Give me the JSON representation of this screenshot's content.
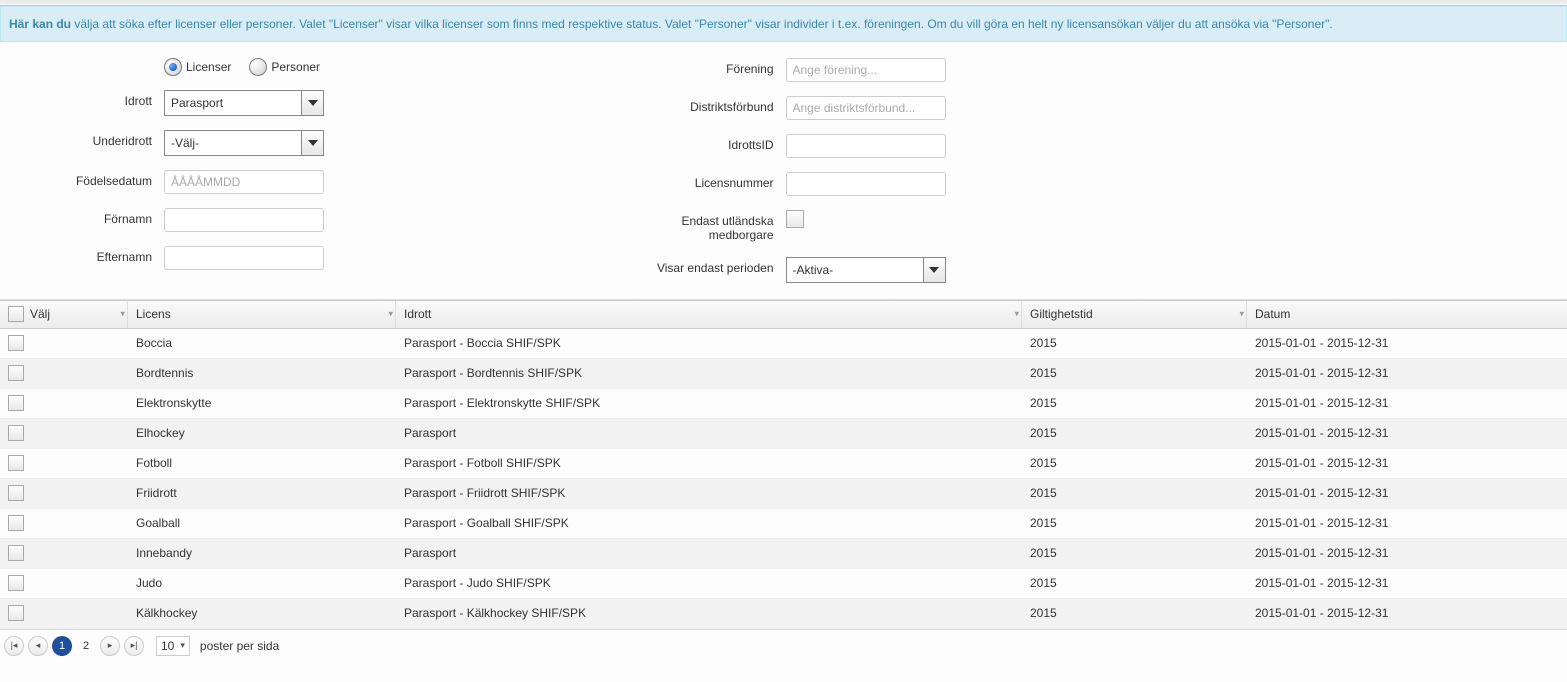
{
  "banner": {
    "bold": "Här kan du",
    "text": " välja att söka efter licenser eller personer. Valet \"Licenser\" visar vilka licenser som finns med respektive status. Valet \"Personer\" visar individer i t.ex. föreningen. Om du vill göra en helt ny licensansökan väljer du att ansöka via \"Personer\"."
  },
  "filters": {
    "radio": {
      "licenser": "Licenser",
      "personer": "Personer",
      "selected": "licenser"
    },
    "idrott_label": "Idrott",
    "idrott_value": "Parasport",
    "underidrott_label": "Underidrott",
    "underidrott_value": "-Välj-",
    "fodelsedatum_label": "Födelsedatum",
    "fodelsedatum_placeholder": "ÅÅÅÅMMDD",
    "fornamn_label": "Förnamn",
    "efternamn_label": "Efternamn",
    "forening_label": "Förening",
    "forening_placeholder": "Ange förening...",
    "distrikt_label": "Distriktsförbund",
    "distrikt_placeholder": "Ange distriktsförbund...",
    "idrottsid_label": "IdrottsID",
    "licensnummer_label": "Licensnummer",
    "endast_label1": "Endast utländska",
    "endast_label2": "medborgare",
    "period_label": "Visar endast perioden",
    "period_value": "-Aktiva-"
  },
  "grid": {
    "headers": {
      "valj": "Välj",
      "licens": "Licens",
      "idrott": "Idrott",
      "giltighetstid": "Giltighetstid",
      "datum": "Datum"
    },
    "rows": [
      {
        "licens": "Boccia",
        "idrott": "Parasport - Boccia SHIF/SPK",
        "gil": "2015",
        "datum": "2015-01-01 - 2015-12-31"
      },
      {
        "licens": "Bordtennis",
        "idrott": "Parasport - Bordtennis SHIF/SPK",
        "gil": "2015",
        "datum": "2015-01-01 - 2015-12-31"
      },
      {
        "licens": "Elektronskytte",
        "idrott": "Parasport - Elektronskytte SHIF/SPK",
        "gil": "2015",
        "datum": "2015-01-01 - 2015-12-31"
      },
      {
        "licens": "Elhockey",
        "idrott": "Parasport",
        "gil": "2015",
        "datum": "2015-01-01 - 2015-12-31"
      },
      {
        "licens": "Fotboll",
        "idrott": "Parasport - Fotboll SHIF/SPK",
        "gil": "2015",
        "datum": "2015-01-01 - 2015-12-31"
      },
      {
        "licens": "Friidrott",
        "idrott": "Parasport - Friidrott SHIF/SPK",
        "gil": "2015",
        "datum": "2015-01-01 - 2015-12-31"
      },
      {
        "licens": "Goalball",
        "idrott": "Parasport - Goalball SHIF/SPK",
        "gil": "2015",
        "datum": "2015-01-01 - 2015-12-31"
      },
      {
        "licens": "Innebandy",
        "idrott": "Parasport",
        "gil": "2015",
        "datum": "2015-01-01 - 2015-12-31"
      },
      {
        "licens": "Judo",
        "idrott": "Parasport - Judo SHIF/SPK",
        "gil": "2015",
        "datum": "2015-01-01 - 2015-12-31"
      },
      {
        "licens": "Kälkhockey",
        "idrott": "Parasport - Kälkhockey SHIF/SPK",
        "gil": "2015",
        "datum": "2015-01-01 - 2015-12-31"
      }
    ]
  },
  "pager": {
    "page1": "1",
    "page2": "2",
    "per_page": "10",
    "per_page_label": "poster per sida"
  }
}
